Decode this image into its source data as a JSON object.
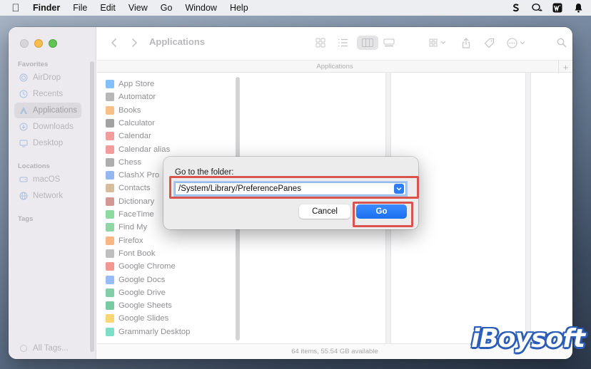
{
  "menubar": {
    "app": "Finder",
    "items": [
      "File",
      "Edit",
      "View",
      "Go",
      "Window",
      "Help"
    ],
    "status_icons": [
      "skype-icon",
      "chat-icon",
      "wps-icon",
      "notification-icon"
    ]
  },
  "sidebar": {
    "favorites_title": "Favorites",
    "favorites": [
      {
        "label": "AirDrop",
        "icon": "airdrop-icon"
      },
      {
        "label": "Recents",
        "icon": "clock-icon"
      },
      {
        "label": "Applications",
        "icon": "applications-icon",
        "selected": true
      },
      {
        "label": "Downloads",
        "icon": "download-icon"
      },
      {
        "label": "Desktop",
        "icon": "desktop-icon"
      }
    ],
    "locations_title": "Locations",
    "locations": [
      {
        "label": "macOS",
        "icon": "disk-icon"
      },
      {
        "label": "Network",
        "icon": "globe-icon"
      }
    ],
    "tags_title": "Tags",
    "all_tags": "All Tags..."
  },
  "toolbar": {
    "title": "Applications"
  },
  "pathbar": {
    "title": "Applications"
  },
  "files": [
    {
      "name": "App Store",
      "color": "#1e8bf2"
    },
    {
      "name": "Automator",
      "color": "#7b7b7b"
    },
    {
      "name": "Books",
      "color": "#f28c28"
    },
    {
      "name": "Calculator",
      "color": "#555555"
    },
    {
      "name": "Calendar",
      "color": "#e84a4a"
    },
    {
      "name": "Calendar alias",
      "color": "#e84a4a"
    },
    {
      "name": "Chess",
      "color": "#6b6b6b"
    },
    {
      "name": "ClashX Pro",
      "color": "#3a7be0"
    },
    {
      "name": "Contacts",
      "color": "#b8864b"
    },
    {
      "name": "Dictionary",
      "color": "#b0433d"
    },
    {
      "name": "FaceTime",
      "color": "#2fbe4f"
    },
    {
      "name": "Find My",
      "color": "#35b25c"
    },
    {
      "name": "Firefox",
      "color": "#f47a20"
    },
    {
      "name": "Font Book",
      "color": "#8a8a8a"
    },
    {
      "name": "Google Chrome",
      "color": "#e94235"
    },
    {
      "name": "Google Docs",
      "color": "#4285f4"
    },
    {
      "name": "Google Drive",
      "color": "#1fa463"
    },
    {
      "name": "Google Sheets",
      "color": "#0f9d58"
    },
    {
      "name": "Google Slides",
      "color": "#f4b400"
    },
    {
      "name": "Grammarly Desktop",
      "color": "#15c39a"
    }
  ],
  "status": "64 items, 55.54 GB available",
  "dialog": {
    "label": "Go to the folder:",
    "path_value": "/System/Library/PreferencePanes",
    "cancel": "Cancel",
    "go": "Go"
  },
  "watermark": "iBoysoft",
  "highlight_color": "#d9534f",
  "accent_color": "#1a6ff0"
}
